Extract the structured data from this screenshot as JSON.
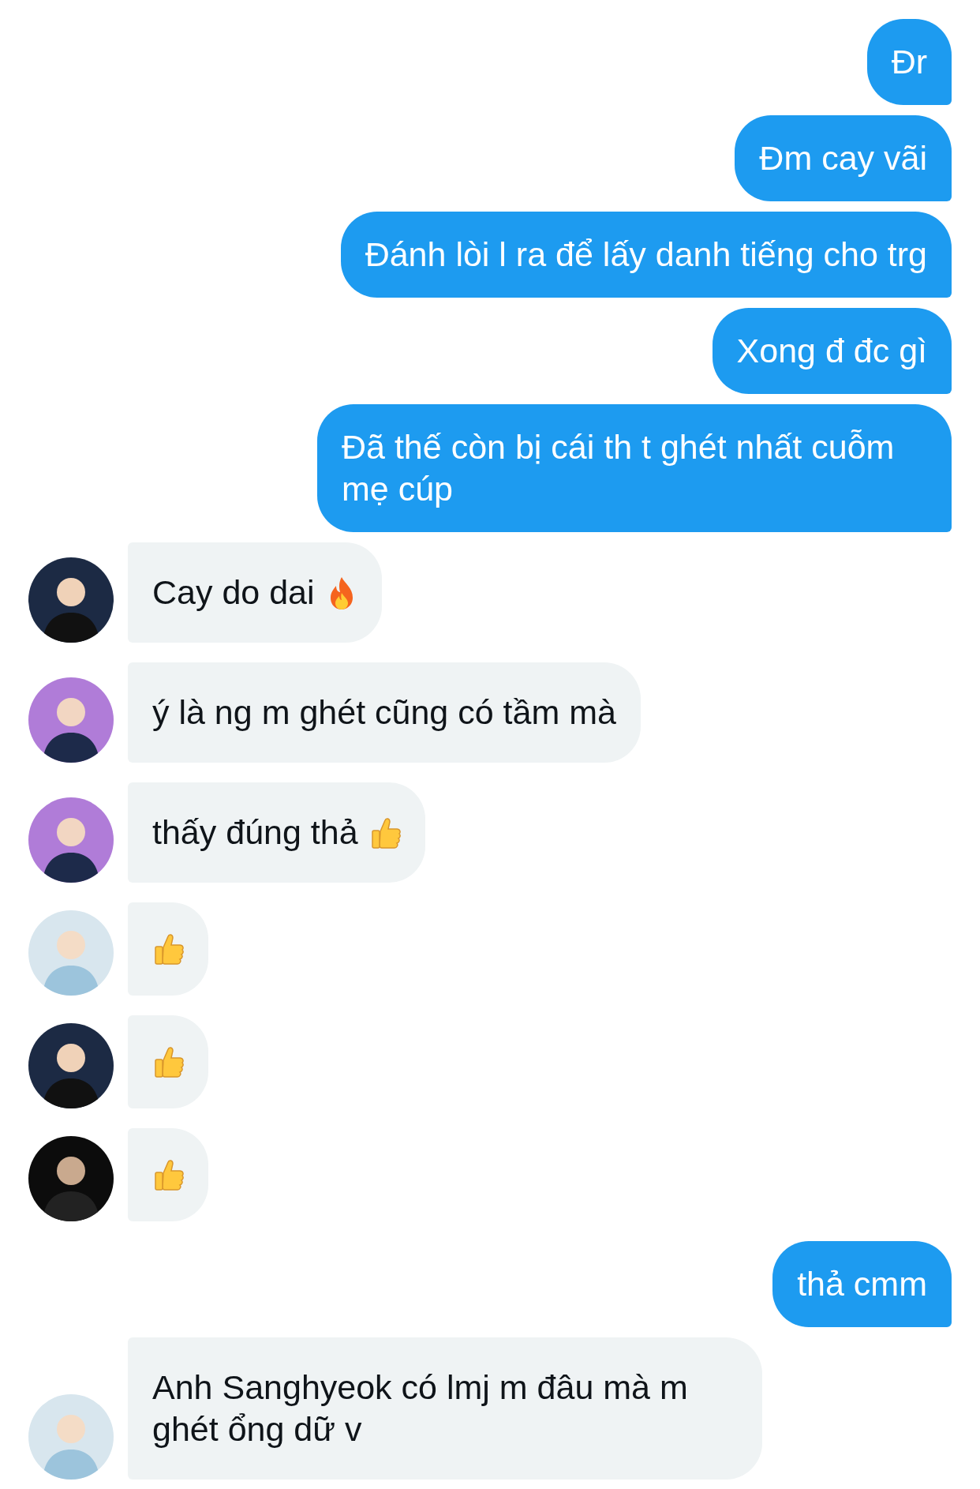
{
  "messages": [
    {
      "outgoing": true,
      "kind": "text",
      "text": "Đr"
    },
    {
      "outgoing": true,
      "kind": "text",
      "text": "Đm cay vãi"
    },
    {
      "outgoing": true,
      "kind": "text",
      "text": "Đánh lòi l ra để lấy danh tiếng cho trg"
    },
    {
      "outgoing": true,
      "kind": "text",
      "text": "Xong đ đc gì"
    },
    {
      "outgoing": true,
      "kind": "text",
      "text": "Đã thế còn bị cái th t ghét nhất cuỗm mẹ cúp"
    },
    {
      "outgoing": false,
      "kind": "text_fire",
      "text": "Cay do dai"
    },
    {
      "outgoing": false,
      "kind": "text",
      "text": "ý là ng m ghét cũng có tầm mà"
    },
    {
      "outgoing": false,
      "kind": "text_thumb",
      "text": "thấy đúng thả"
    },
    {
      "outgoing": false,
      "kind": "thumb"
    },
    {
      "outgoing": false,
      "kind": "thumb"
    },
    {
      "outgoing": false,
      "kind": "thumb"
    },
    {
      "outgoing": true,
      "kind": "text",
      "text": "thả cmm"
    },
    {
      "outgoing": false,
      "kind": "text",
      "text": "Anh Sanghyeok có lmj m đâu mà m ghét ổng dữ v"
    }
  ]
}
